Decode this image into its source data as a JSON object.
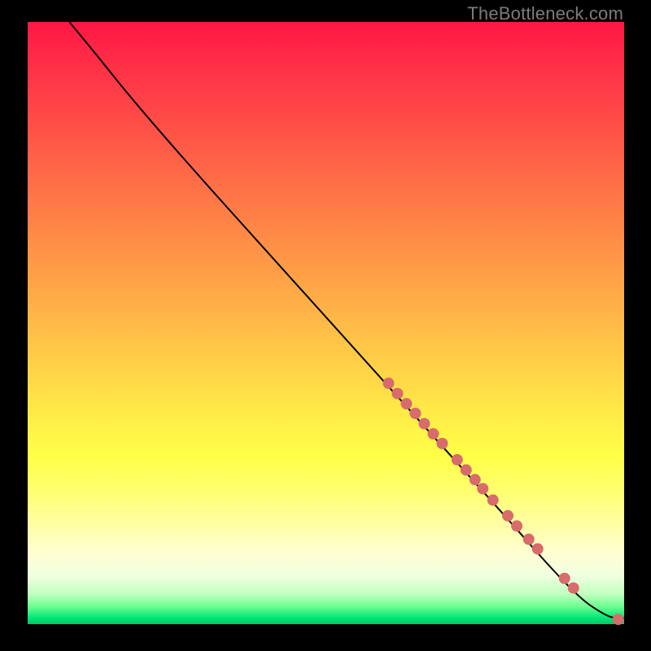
{
  "watermark": "TheBottleneck.com",
  "chart_data": {
    "type": "line",
    "title": "",
    "xlabel": "",
    "ylabel": "",
    "xlim": [
      0,
      100
    ],
    "ylim": [
      0,
      100
    ],
    "grid": false,
    "legend": false,
    "background": "vertical-gradient red-yellow-green",
    "curve": [
      {
        "x": 7,
        "y": 100
      },
      {
        "x": 12,
        "y": 94
      },
      {
        "x": 16,
        "y": 89
      },
      {
        "x": 22,
        "y": 82
      },
      {
        "x": 30,
        "y": 73
      },
      {
        "x": 40,
        "y": 62
      },
      {
        "x": 50,
        "y": 51
      },
      {
        "x": 60,
        "y": 40
      },
      {
        "x": 70,
        "y": 29
      },
      {
        "x": 80,
        "y": 18
      },
      {
        "x": 88,
        "y": 9
      },
      {
        "x": 93,
        "y": 4
      },
      {
        "x": 96,
        "y": 2
      },
      {
        "x": 98,
        "y": 1
      },
      {
        "x": 100,
        "y": 1
      }
    ],
    "points": [
      {
        "x": 60.5,
        "y": 40.0,
        "r": 7
      },
      {
        "x": 62.0,
        "y": 38.3,
        "r": 7
      },
      {
        "x": 63.5,
        "y": 36.6,
        "r": 7
      },
      {
        "x": 65.0,
        "y": 35.0,
        "r": 7
      },
      {
        "x": 66.5,
        "y": 33.3,
        "r": 7
      },
      {
        "x": 68.0,
        "y": 31.6,
        "r": 7
      },
      {
        "x": 69.5,
        "y": 30.0,
        "r": 7
      },
      {
        "x": 72.0,
        "y": 27.3,
        "r": 7
      },
      {
        "x": 73.5,
        "y": 25.6,
        "r": 7
      },
      {
        "x": 75.0,
        "y": 24.0,
        "r": 7
      },
      {
        "x": 76.3,
        "y": 22.5,
        "r": 7
      },
      {
        "x": 78.0,
        "y": 20.6,
        "r": 7
      },
      {
        "x": 80.5,
        "y": 18.0,
        "r": 7
      },
      {
        "x": 82.0,
        "y": 16.3,
        "r": 7
      },
      {
        "x": 84.0,
        "y": 14.1,
        "r": 7
      },
      {
        "x": 85.5,
        "y": 12.5,
        "r": 7
      },
      {
        "x": 90.0,
        "y": 7.6,
        "r": 7
      },
      {
        "x": 91.5,
        "y": 6.0,
        "r": 7
      },
      {
        "x": 99.0,
        "y": 0.8,
        "r": 7
      }
    ]
  }
}
